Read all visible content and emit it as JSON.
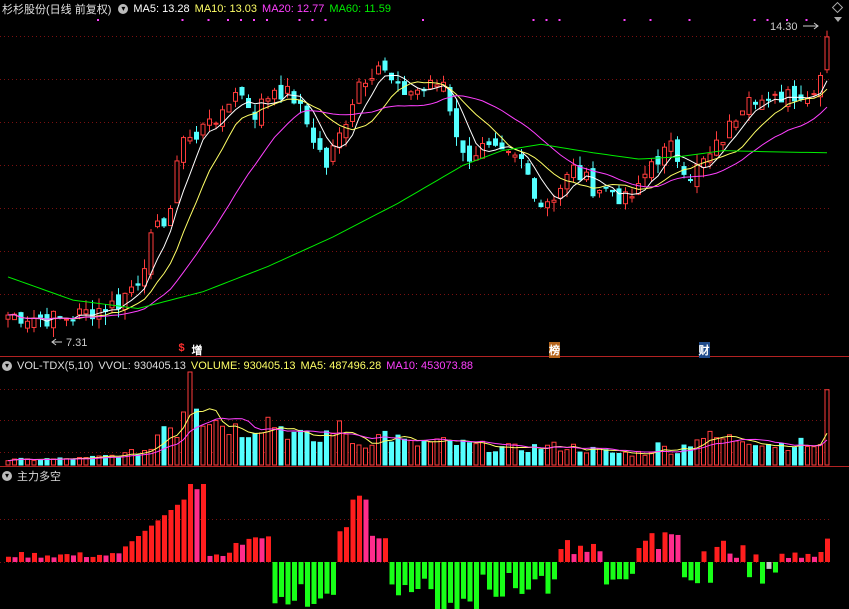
{
  "price_header": {
    "title": "杉杉股份(日线 前复权)",
    "ma5": "MA5: 13.28",
    "ma10": "MA10: 13.03",
    "ma20": "MA20: 12.77",
    "ma60": "MA60: 11.59"
  },
  "vol_header": {
    "indicator": "VOL-TDX(5,10)",
    "vvol": "VVOL: 930405.13",
    "volume": "VOLUME: 930405.13",
    "ma5": "MA5: 487496.28",
    "ma10": "MA10: 453073.88"
  },
  "flow_header": {
    "title": "主力多空"
  },
  "events": [
    {
      "label": "$",
      "index": 27,
      "color": "#ff3030"
    },
    {
      "label": "增",
      "index": 29,
      "color": "#ffffff"
    },
    {
      "label": "榜",
      "index": 84,
      "color": "#ffffff"
    },
    {
      "label": "财",
      "index": 107,
      "color": "#ffffff"
    }
  ],
  "annotations": {
    "high_label": "14.30",
    "low_label": "7.31"
  },
  "colors": {
    "up": "#ff3c3c",
    "down": "#54ffff",
    "ma5": "#ffff66",
    "ma10": "#ffffff",
    "ma20": "#ff40ff",
    "ma60": "#00ee00",
    "flow_up_strong": "#ff1e1e",
    "flow_up_weak": "#ff2c8c",
    "flow_down_strong": "#18ff18",
    "flow_down_weak": "#c8c8c8"
  },
  "chart_data": [
    {
      "type": "candlestick",
      "title": "杉杉股份(日线 前复权)",
      "ylim": [
        7.0,
        14.6
      ],
      "grid": true,
      "high": 14.3,
      "low": 7.31,
      "anchors": [
        [
          0,
          7.55
        ],
        [
          8,
          7.45
        ],
        [
          12,
          7.6
        ],
        [
          17,
          7.85
        ],
        [
          20,
          8.4
        ],
        [
          22,
          9.3
        ],
        [
          25,
          10.1
        ],
        [
          27,
          11.9
        ],
        [
          29,
          11.7
        ],
        [
          31,
          12.3
        ],
        [
          33,
          12.2
        ],
        [
          35,
          12.95
        ],
        [
          38,
          12.35
        ],
        [
          41,
          12.95
        ],
        [
          44,
          12.7
        ],
        [
          46,
          12.1
        ],
        [
          49,
          11.1
        ],
        [
          51,
          11.8
        ],
        [
          54,
          13.1
        ],
        [
          57,
          13.5
        ],
        [
          60,
          12.85
        ],
        [
          64,
          12.9
        ],
        [
          67,
          13.1
        ],
        [
          70,
          11.3
        ],
        [
          73,
          11.5
        ],
        [
          76,
          11.3
        ],
        [
          79,
          11.2
        ],
        [
          82,
          10.2
        ],
        [
          84,
          10.4
        ],
        [
          87,
          11.0
        ],
        [
          90,
          10.6
        ],
        [
          93,
          10.5
        ],
        [
          95,
          10.25
        ],
        [
          97,
          10.5
        ],
        [
          99,
          11.2
        ],
        [
          102,
          11.5
        ],
        [
          105,
          10.9
        ],
        [
          108,
          11.3
        ],
        [
          111,
          12.0
        ],
        [
          114,
          12.9
        ],
        [
          117,
          12.5
        ],
        [
          120,
          12.9
        ],
        [
          123,
          12.7
        ],
        [
          125,
          13.3
        ],
        [
          126,
          14.2
        ]
      ],
      "ma60_points": [
        [
          0,
          8.45
        ],
        [
          10,
          7.9
        ],
        [
          20,
          7.7
        ],
        [
          30,
          8.1
        ],
        [
          40,
          8.7
        ],
        [
          50,
          9.4
        ],
        [
          60,
          10.2
        ],
        [
          70,
          11.1
        ],
        [
          76,
          11.45
        ],
        [
          82,
          11.6
        ],
        [
          90,
          11.4
        ],
        [
          97,
          11.25
        ],
        [
          103,
          11.3
        ],
        [
          110,
          11.45
        ],
        [
          118,
          11.42
        ],
        [
          126,
          11.4
        ]
      ]
    },
    {
      "type": "bar",
      "title": "VOL-TDX(5,10)",
      "ylim": [
        0,
        1150000
      ],
      "anchors": [
        [
          0,
          60000
        ],
        [
          12,
          80000
        ],
        [
          18,
          130000
        ],
        [
          22,
          200000
        ],
        [
          24,
          600000
        ],
        [
          26,
          400000
        ],
        [
          28,
          1150000
        ],
        [
          30,
          600000
        ],
        [
          33,
          530000
        ],
        [
          36,
          420000
        ],
        [
          40,
          560000
        ],
        [
          44,
          380000
        ],
        [
          48,
          280000
        ],
        [
          50,
          500000
        ],
        [
          54,
          250000
        ],
        [
          58,
          380000
        ],
        [
          62,
          250000
        ],
        [
          66,
          280000
        ],
        [
          70,
          250000
        ],
        [
          74,
          220000
        ],
        [
          78,
          200000
        ],
        [
          82,
          220000
        ],
        [
          86,
          230000
        ],
        [
          90,
          180000
        ],
        [
          94,
          140000
        ],
        [
          98,
          150000
        ],
        [
          100,
          230000
        ],
        [
          103,
          170000
        ],
        [
          106,
          350000
        ],
        [
          110,
          320000
        ],
        [
          114,
          330000
        ],
        [
          118,
          250000
        ],
        [
          122,
          260000
        ],
        [
          125,
          230000
        ],
        [
          126,
          930405
        ]
      ]
    },
    {
      "type": "bar",
      "title": "主力多空",
      "ylim": [
        -1.0,
        1.0
      ]
    }
  ]
}
